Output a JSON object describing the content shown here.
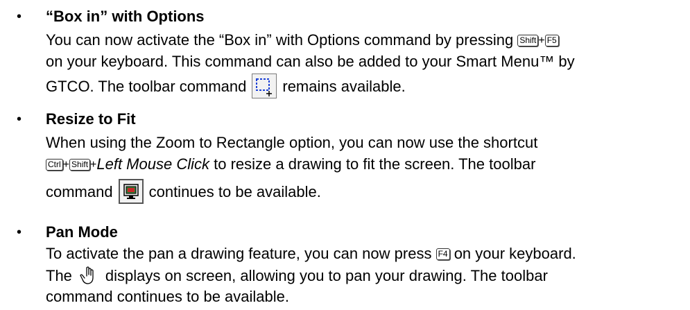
{
  "items": [
    {
      "bullet": "•",
      "title": "“Box in” with Options",
      "line1_a": "You can now activate the “Box in” with Options command by pressing ",
      "key1": "Shift",
      "plus": "+",
      "key2": "F5",
      "line2": "on your keyboard. This command can also be added to your Smart Menu™ by",
      "line3_a": "GTCO. The toolbar command",
      "line3_b": "remains available.",
      "icon": "box-in-icon"
    },
    {
      "bullet": "•",
      "title": "Resize to Fit",
      "line1": "When using the Zoom to Rectangle option, you can now use the shortcut",
      "key1": "Ctrl",
      "plus1": "+",
      "key2": "Shift",
      "plus2": "+",
      "italic": "Left Mouse Click",
      "line2_b": " to resize a drawing to fit the screen. The toolbar",
      "line3_a": "command",
      "line3_b": "continues to be available.",
      "icon": "monitor-fit-icon"
    },
    {
      "bullet": "•",
      "title": "Pan Mode",
      "line1_a": "To activate the pan a drawing feature, you can now press ",
      "key1": "F4",
      "line1_b": " on your keyboard.",
      "line2_a": "The",
      "line2_b": "displays on screen, allowing you to pan your drawing. The toolbar",
      "line3": "command continues to be available.",
      "icon": "hand-pointer-icon"
    }
  ]
}
